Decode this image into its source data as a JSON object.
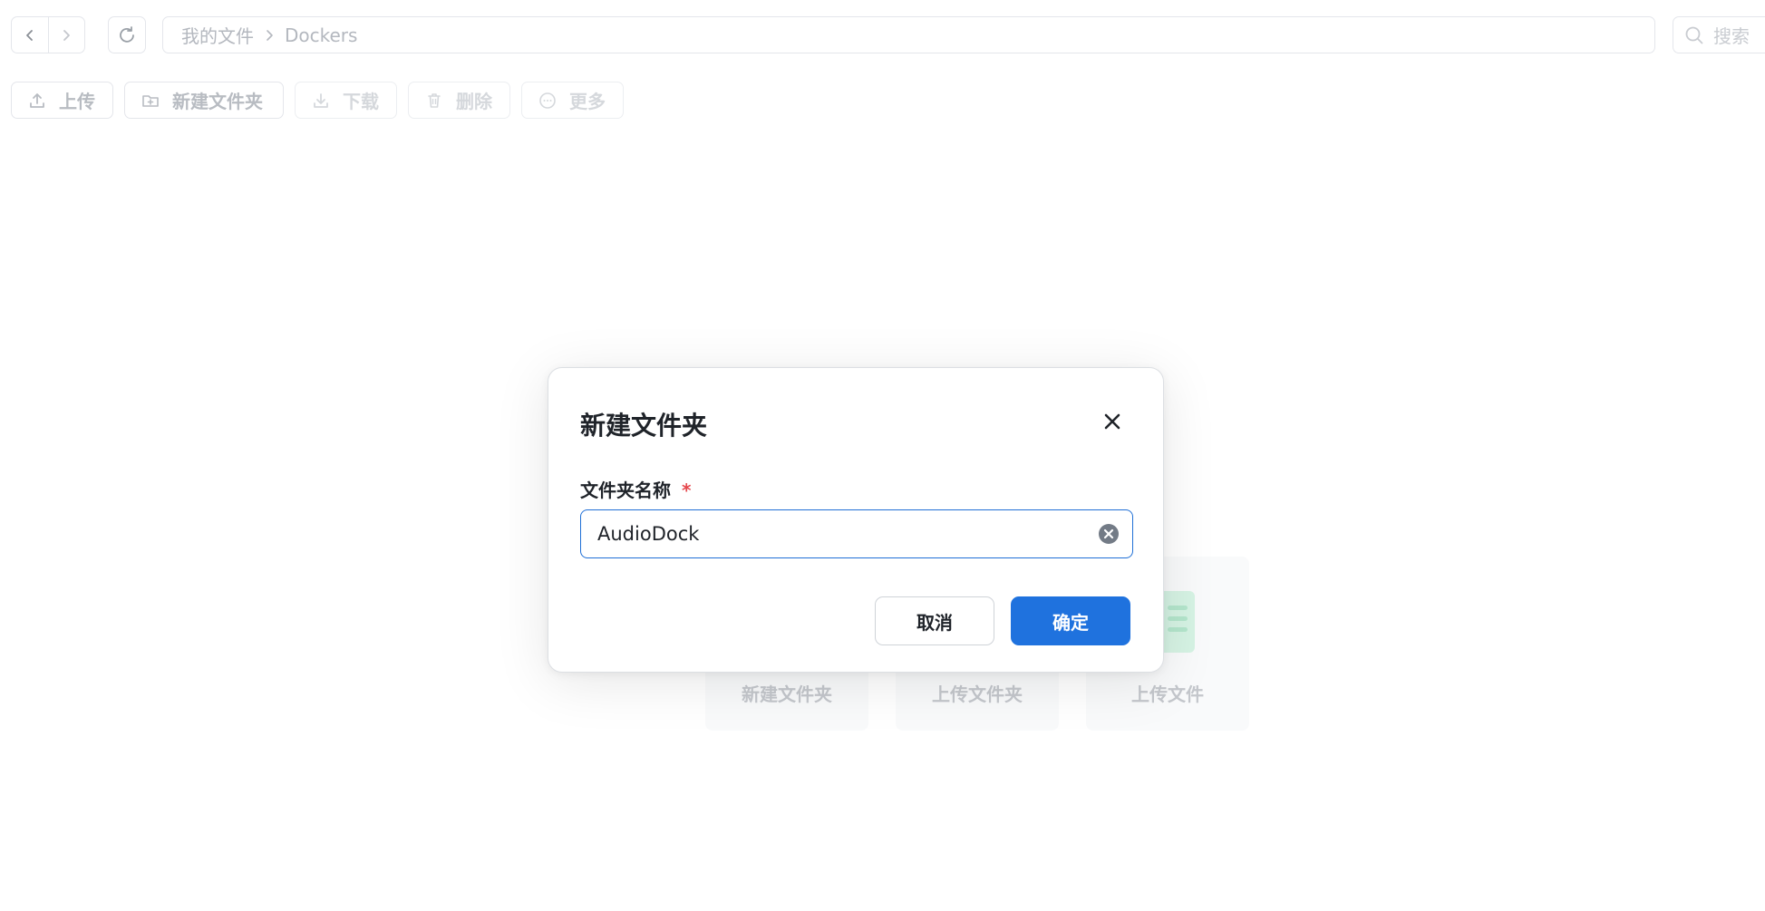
{
  "breadcrumb": {
    "root": "我的文件",
    "current": "Dockers"
  },
  "search": {
    "placeholder": "搜索"
  },
  "toolbar": {
    "upload": "上传",
    "new_folder": "新建文件夹",
    "download": "下载",
    "delete": "删除",
    "more": "更多"
  },
  "empty_state": {
    "cards": [
      "新建文件夹",
      "上传文件夹",
      "上传文件"
    ]
  },
  "dialog": {
    "title": "新建文件夹",
    "field_label": "文件夹名称",
    "required_mark": "*",
    "input_value": "AudioDock",
    "cancel_label": "取消",
    "confirm_label": "确定"
  },
  "colors": {
    "primary": "#1f72de",
    "required": "#e5484d",
    "border": "#e4e6eb",
    "muted_text": "#b4b8bf"
  }
}
